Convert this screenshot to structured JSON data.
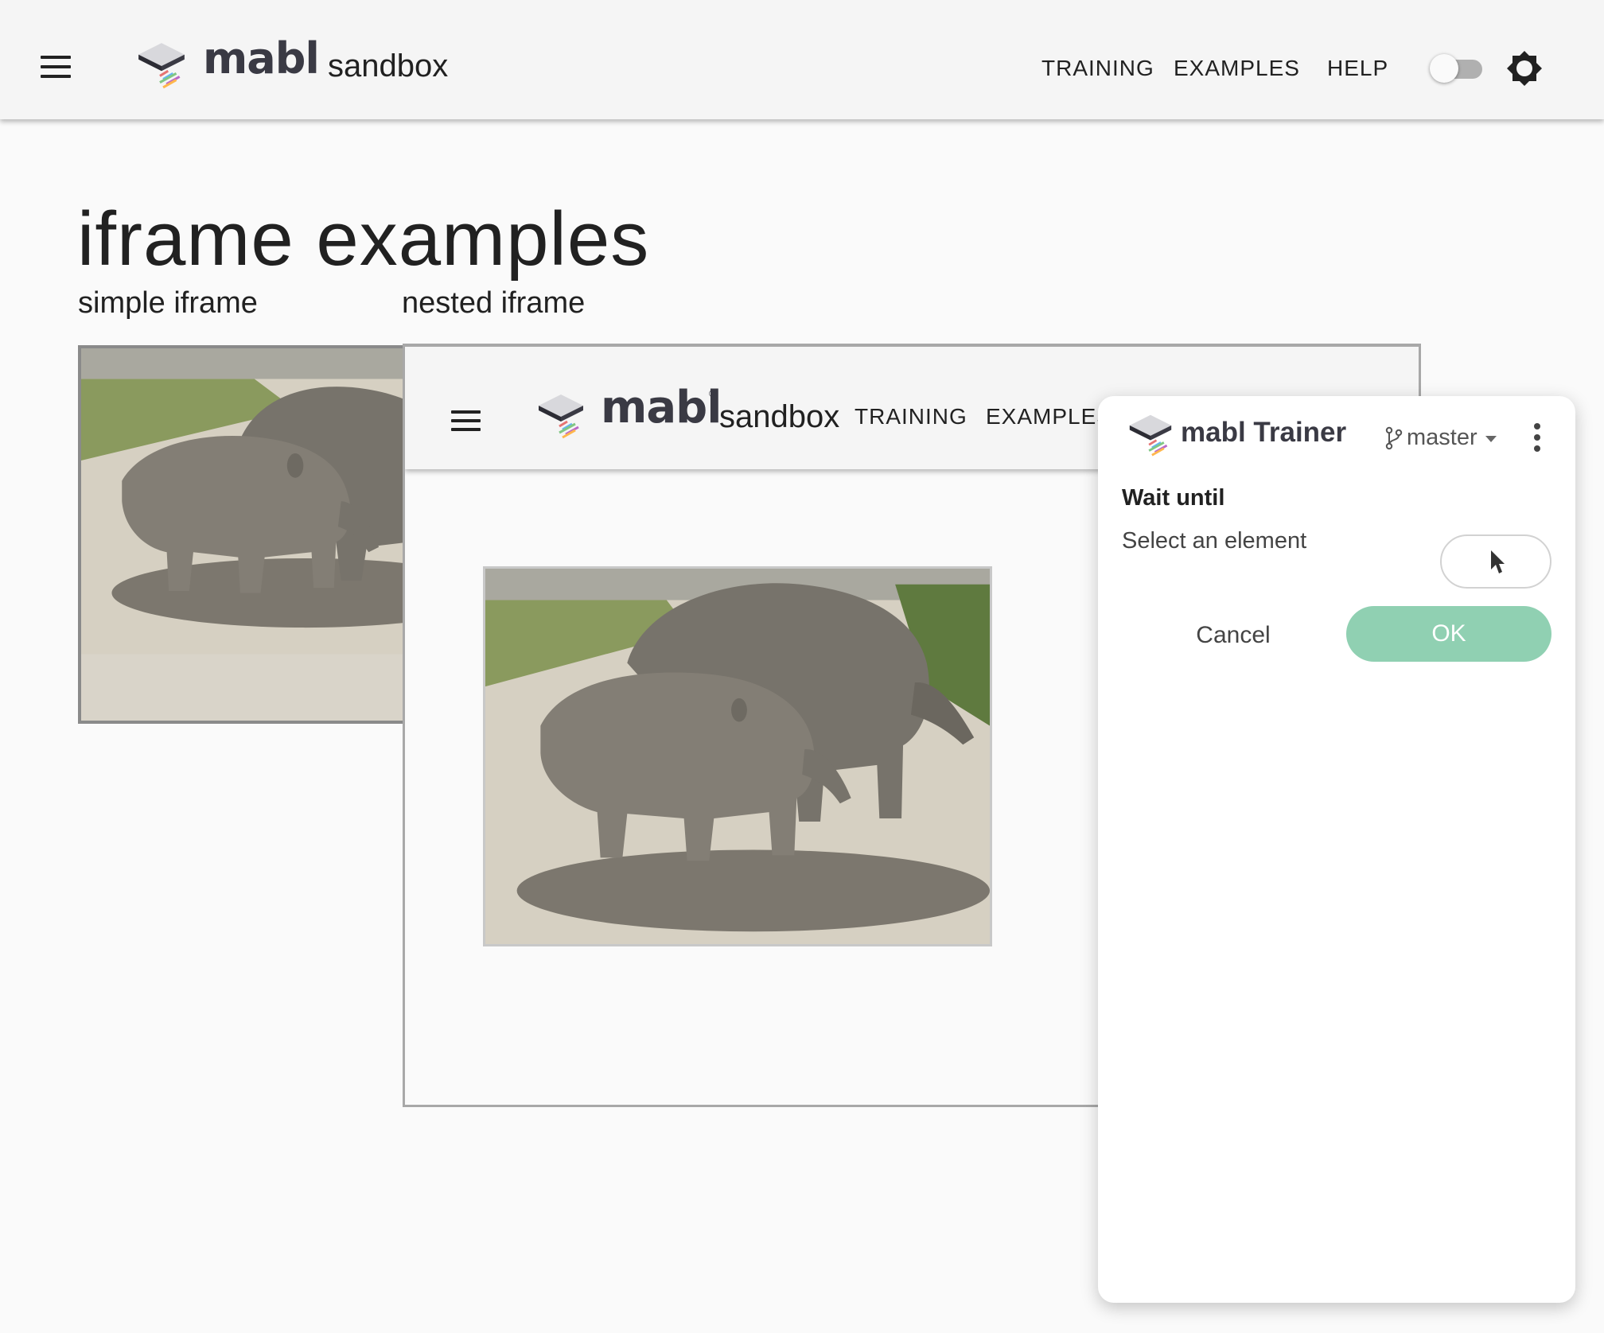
{
  "app": {
    "brand": "mabl",
    "brand_mark": "®",
    "product": "sandbox"
  },
  "nav": {
    "training": "TRAINING",
    "examples": "EXAMPLES",
    "help": "HELP"
  },
  "page": {
    "title": "iframe examples",
    "simple_label": "simple iframe",
    "nested_label": "nested iframe"
  },
  "nested_frame": {
    "brand": "mabl",
    "brand_mark": "®",
    "product": "sandbox",
    "training": "TRAINING",
    "examples": "EXAMPLES"
  },
  "trainer": {
    "title": "mabl Trainer",
    "branch": "master",
    "step_title": "Wait until",
    "prompt": "Select an element",
    "cancel_label": "Cancel",
    "ok_label": "OK"
  },
  "colors": {
    "appbar_bg": "#f5f5f5",
    "page_bg": "#fafafa",
    "ok_button": "#90d0b2",
    "brand_text": "#3a3a44"
  },
  "icons": {
    "menu": "hamburger-menu-icon",
    "theme": "gear-icon",
    "branch": "git-branch-icon",
    "more": "kebab-icon",
    "picker": "cursor-icon"
  }
}
